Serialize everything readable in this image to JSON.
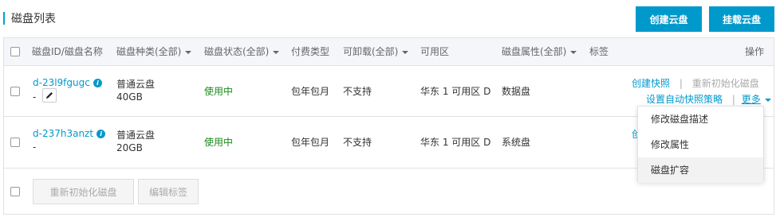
{
  "header": {
    "title": "磁盘列表",
    "create_button": "创建云盘",
    "mount_button": "挂载云盘"
  },
  "columns": {
    "id_name": "磁盘ID/磁盘名称",
    "type": "磁盘种类(全部)",
    "status": "磁盘状态(全部)",
    "billing": "付费类型",
    "detachable": "可卸载(全部)",
    "zone": "可用区",
    "attribute": "磁盘属性(全部)",
    "tags": "标签",
    "actions": "操作"
  },
  "rows": [
    {
      "id": "d-23l9fgugc",
      "name": "-",
      "type": "普通云盘",
      "size": "40GB",
      "status": "使用中",
      "billing": "包年包月",
      "detachable": "不支持",
      "zone": "华东 1 可用区 D",
      "attribute": "数据盘",
      "action_snapshot": "创建快照",
      "action_separator": "|",
      "action_reinit": "重新初始化磁盘",
      "action_auto_snapshot": "设置自动快照策略",
      "action_more": "更多"
    },
    {
      "id": "d-237h3anzt",
      "name": "-",
      "type": "普通云盘",
      "size": "20GB",
      "status": "使用中",
      "billing": "包年包月",
      "detachable": "不支持",
      "zone": "华东 1 可用区 D",
      "attribute": "系统盘",
      "action_partial": "创"
    }
  ],
  "footer": {
    "reinit_button": "重新初始化磁盘",
    "edit_tags_button": "编辑标签"
  },
  "dropdown": {
    "items": [
      "修改磁盘描述",
      "修改属性",
      "磁盘扩容"
    ]
  },
  "icons": {
    "info": "info-icon",
    "edit": "pencil-icon",
    "caret": "caret-down-icon"
  },
  "colors": {
    "primary": "#0099cc",
    "status_ok": "#1a8a1a"
  }
}
